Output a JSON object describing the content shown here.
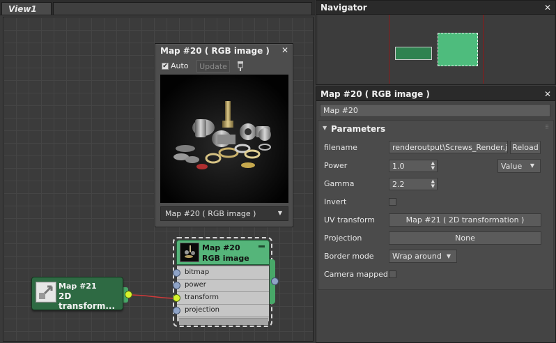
{
  "view": {
    "tab_label": "View1"
  },
  "preview_window": {
    "title": "Map #20  ( RGB image )",
    "auto_label": "Auto",
    "auto_checked": true,
    "update_label": "Update",
    "select_value": "Map #20  ( RGB image )"
  },
  "nodes": {
    "map21": {
      "title": "Map #21",
      "subtitle": "2D transform..."
    },
    "map20": {
      "title": "Map #20",
      "subtitle": "RGB image",
      "sockets": [
        "bitmap",
        "power",
        "transform",
        "projection"
      ]
    }
  },
  "navigator": {
    "title": "Navigator"
  },
  "params_panel": {
    "title": "Map #20  ( RGB image )",
    "name_value": "Map #20",
    "rollout_title": "Parameters",
    "rows": {
      "filename": {
        "label": "filename",
        "value": "renderoutput\\Screws_Render.jpg",
        "reload_label": "Reload"
      },
      "power": {
        "label": "Power",
        "value": "1.0",
        "mode": "Value"
      },
      "gamma": {
        "label": "Gamma",
        "value": "2.2"
      },
      "invert": {
        "label": "Invert",
        "checked": false
      },
      "uv_transform": {
        "label": "UV transform",
        "value": "Map #21  ( 2D transformation )"
      },
      "projection": {
        "label": "Projection",
        "value": "None"
      },
      "border_mode": {
        "label": "Border mode",
        "value": "Wrap around"
      },
      "camera_mapped": {
        "label": "Camera mapped",
        "checked": false
      }
    }
  },
  "colors": {
    "node_dark_green": "#2e6a43",
    "node_light_green": "#55b57a",
    "socket_active": "#d7f32c",
    "wire": "#d03a3a",
    "navigator_line": "#8b1a1a"
  },
  "icons": [
    "close-icon",
    "pin-icon",
    "dropdown-arrow-icon",
    "spinner-icon",
    "checkbox-icon",
    "grip-icon",
    "collapse-arrow-icon"
  ]
}
